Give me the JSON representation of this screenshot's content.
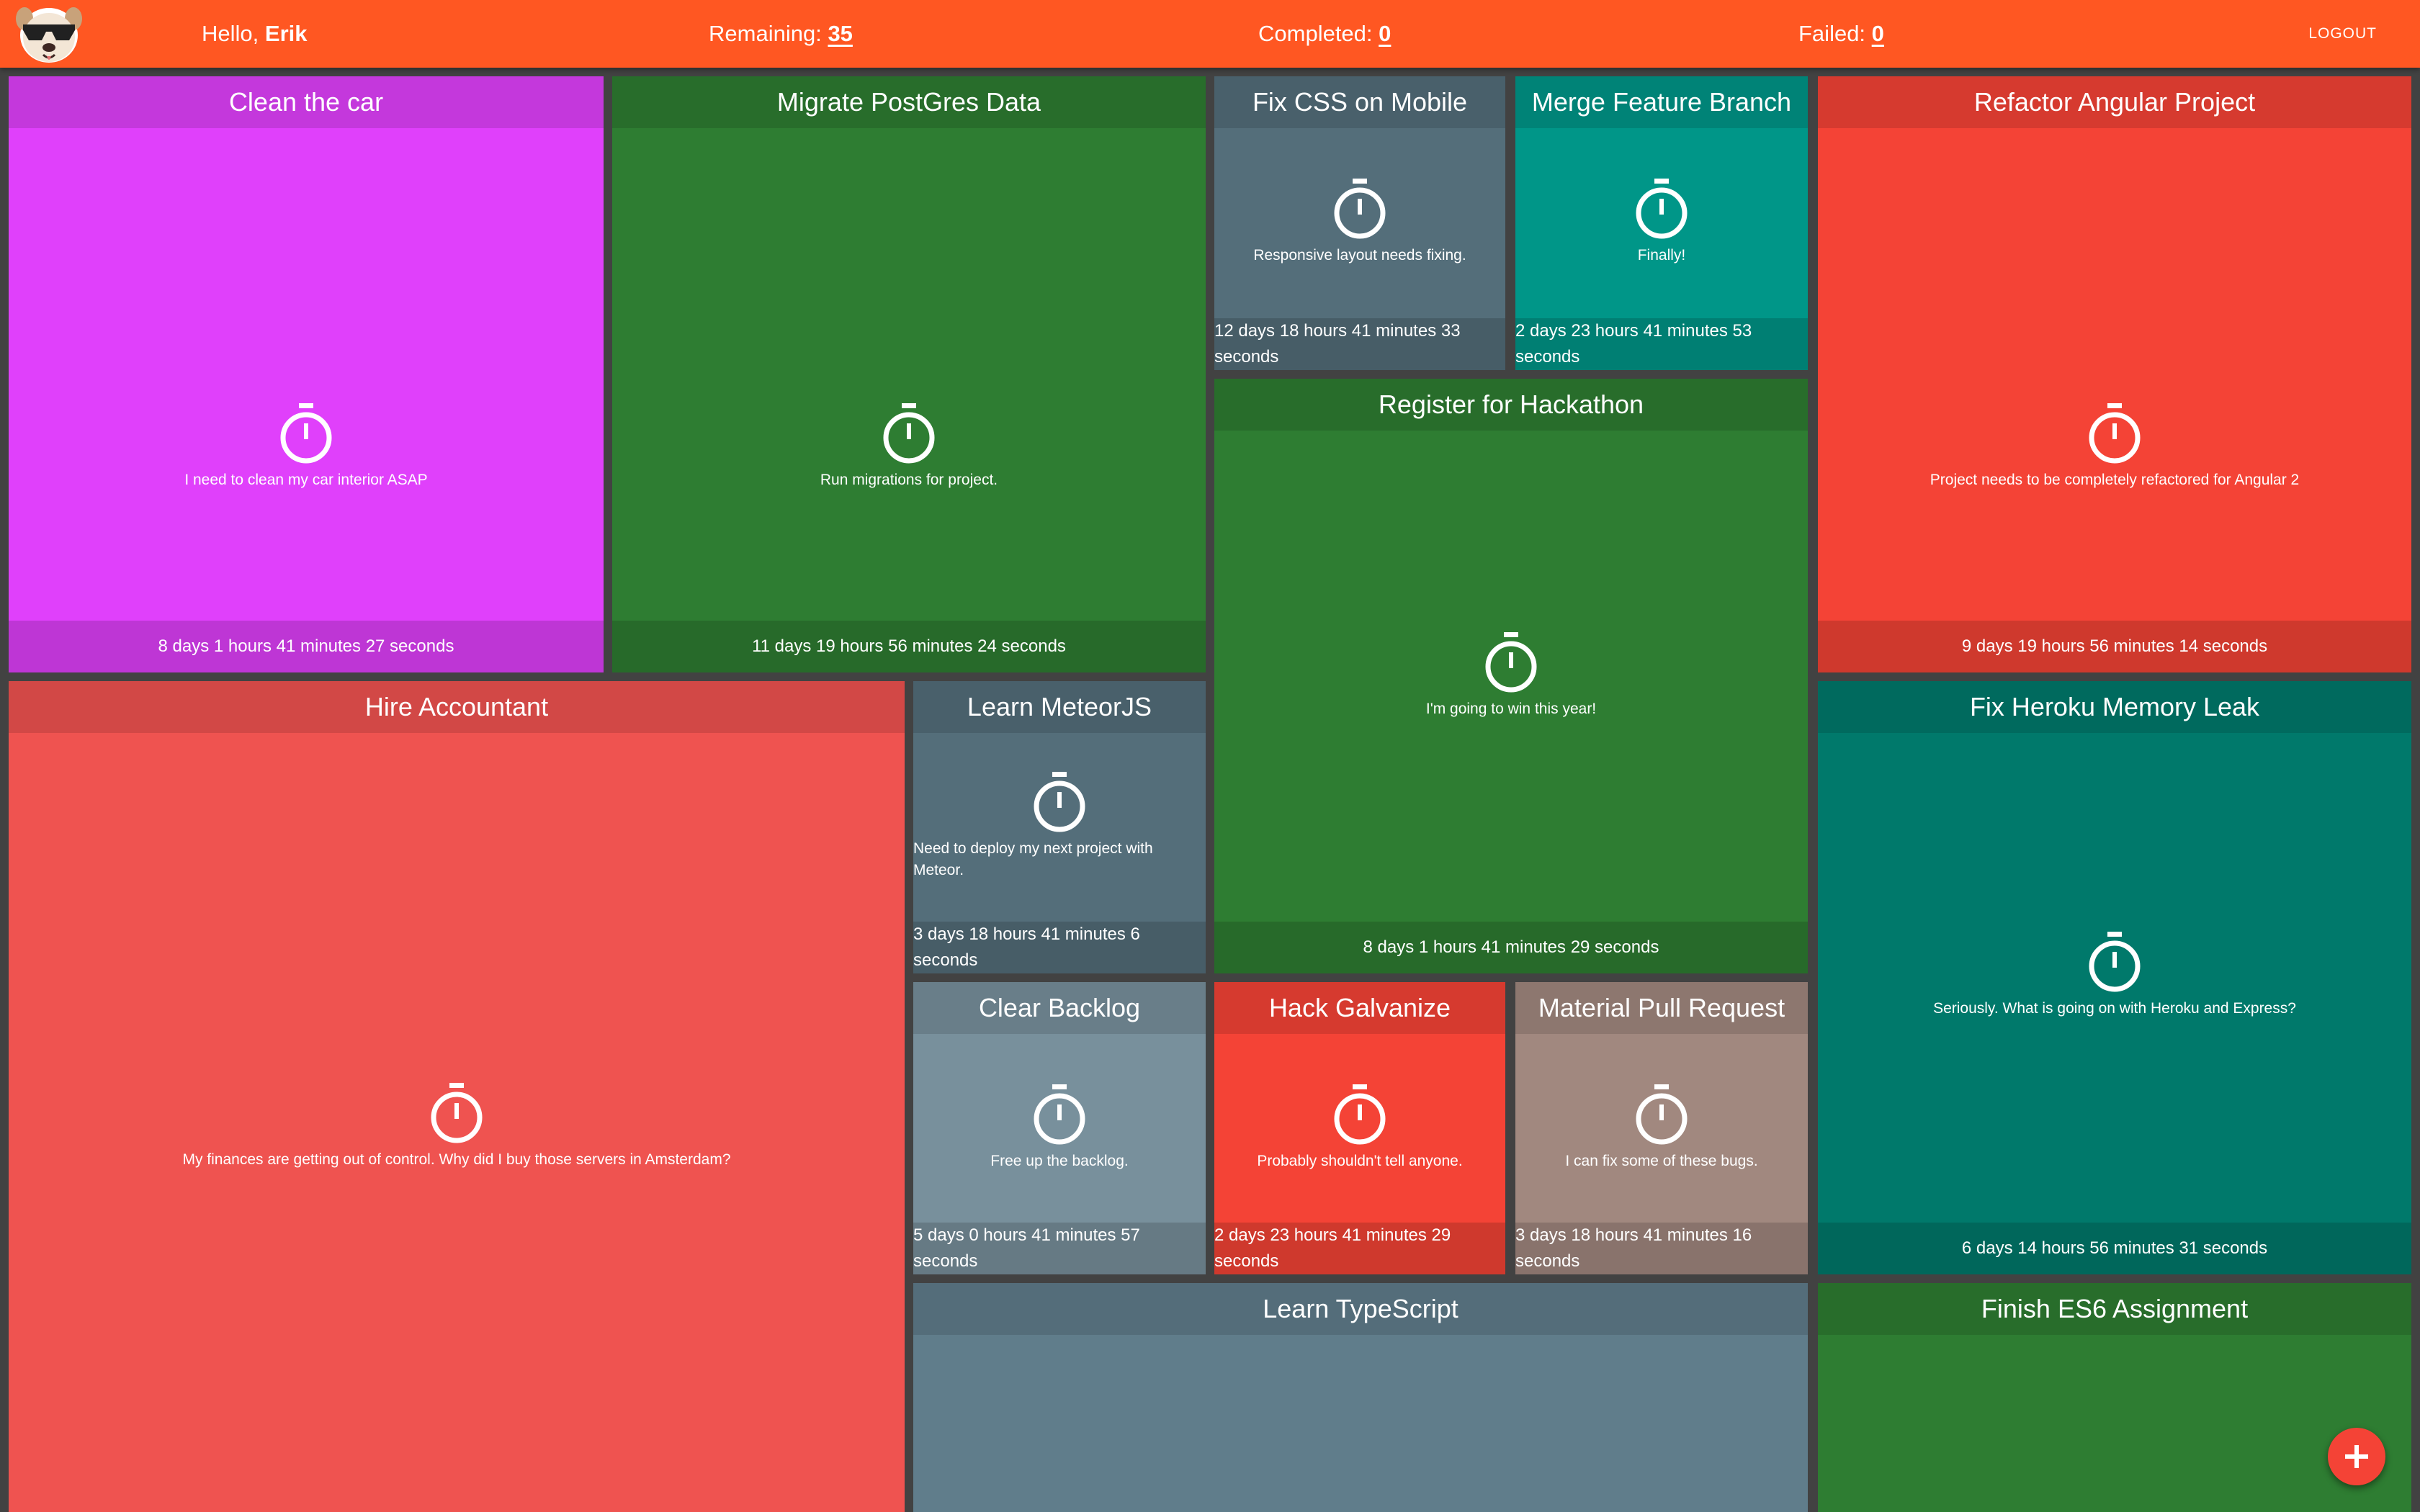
{
  "header": {
    "greeting_prefix": "Hello,",
    "user_name": "Erik",
    "remaining_label": "Remaining:",
    "remaining_count": "35",
    "completed_label": "Completed:",
    "completed_count": "0",
    "failed_label": "Failed:",
    "failed_count": "0",
    "logout_label": "LOGOUT",
    "logo_icon": "cool-dog-logo-icon",
    "color": "#ff5722"
  },
  "cards": [
    {
      "title": "Clean the car",
      "description": "I need to clean my car interior ASAP",
      "countdown": "8 days 1 hours 41 minutes 27 seconds",
      "color": "#e040fb",
      "icon": "stopwatch-icon"
    },
    {
      "title": "Migrate PostGres Data",
      "description": "Run migrations for project.",
      "countdown": "11 days 19 hours 56 minutes 24 seconds",
      "color": "#2e7d32",
      "icon": "stopwatch-icon"
    },
    {
      "title": "Fix CSS on Mobile",
      "description": "Responsive layout needs fixing.",
      "countdown": "12 days 18 hours 41 minutes 33 seconds",
      "color": "#546e7a",
      "icon": "stopwatch-icon"
    },
    {
      "title": "Merge Feature Branch",
      "description": "Finally!",
      "countdown": "2 days 23 hours 41 minutes 53 seconds",
      "color": "#009688",
      "icon": "stopwatch-icon"
    },
    {
      "title": "Refactor Angular Project",
      "description": "Project needs to be completely refactored for Angular 2",
      "countdown": "9 days 19 hours 56 minutes 14 seconds",
      "color": "#f44336",
      "icon": "stopwatch-icon"
    },
    {
      "title": "Register for Hackathon",
      "description": "I'm going to win this year!",
      "countdown": "8 days 1 hours 41 minutes 29 seconds",
      "color": "#2e7d32",
      "icon": "stopwatch-icon"
    },
    {
      "title": "Hire Accountant",
      "description": "My finances are getting out of control. Why did I buy those servers in Amsterdam?",
      "countdown": "",
      "color": "#ef5350",
      "icon": "stopwatch-icon"
    },
    {
      "title": "Learn MeteorJS",
      "description": "Need to deploy my next project with Meteor.",
      "countdown": "3 days 18 hours 41 minutes 6 seconds",
      "color": "#546e7a",
      "icon": "stopwatch-icon"
    },
    {
      "title": "Fix Heroku Memory Leak",
      "description": "Seriously. What is going on with Heroku and Express?",
      "countdown": "6 days 14 hours 56 minutes 31 seconds",
      "color": "#00796b",
      "icon": "stopwatch-icon"
    },
    {
      "title": "Clear Backlog",
      "description": "Free up the backlog.",
      "countdown": "5 days 0 hours 41 minutes 57 seconds",
      "color": "#78909c",
      "icon": "stopwatch-icon"
    },
    {
      "title": "Hack Galvanize",
      "description": "Probably shouldn't tell anyone.",
      "countdown": "2 days 23 hours 41 minutes 29 seconds",
      "color": "#f44336",
      "icon": "stopwatch-icon"
    },
    {
      "title": "Material Pull Request",
      "description": "I can fix some of these bugs.",
      "countdown": "3 days 18 hours 41 minutes 16 seconds",
      "color": "#a1887f",
      "icon": "stopwatch-icon"
    },
    {
      "title": "Learn TypeScript",
      "description": "",
      "countdown": "",
      "color": "#607d8b",
      "icon": "stopwatch-icon"
    },
    {
      "title": "Finish ES6 Assignment",
      "description": "",
      "countdown": "",
      "color": "#2e7d32",
      "icon": "stopwatch-icon"
    }
  ],
  "fab": {
    "icon": "plus-icon",
    "color": "#f44336"
  }
}
